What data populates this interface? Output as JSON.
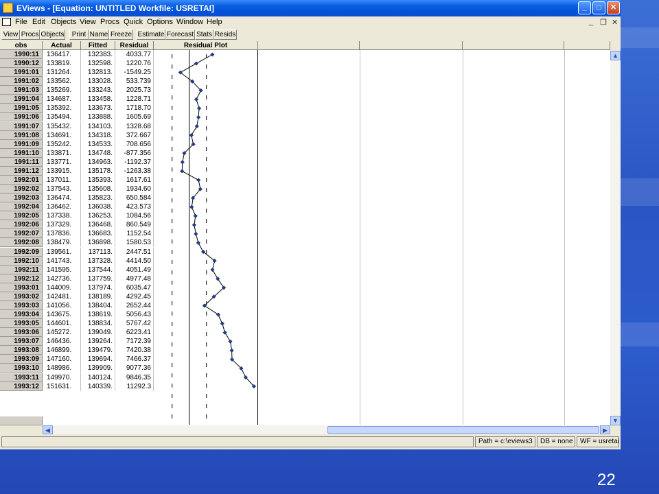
{
  "window": {
    "title": "EViews - [Equation: UNTITLED   Workfile: USRETAI]",
    "controls": {
      "minimize": "_",
      "restore": "□",
      "close": "✕"
    }
  },
  "menu": {
    "items": [
      "File",
      "Edit",
      "Objects",
      "View",
      "Procs",
      "Quick",
      "Options",
      "Window",
      "Help"
    ],
    "mdi": {
      "minimize": "_",
      "restore": "❐",
      "close": "✕"
    }
  },
  "toolbar": {
    "buttons": [
      "View",
      "Procs",
      "Objects",
      "Print",
      "Name",
      "Freeze",
      "Estimate",
      "Forecast",
      "Stats",
      "Resids"
    ]
  },
  "table": {
    "headers": {
      "obs": "obs",
      "actual": "Actual",
      "fitted": "Fitted",
      "residual": "Residual",
      "plot": "Residual Plot"
    },
    "rows": [
      {
        "obs": "1990:11",
        "actual": "136417.",
        "fitted": "132383.",
        "residual": "4033.77"
      },
      {
        "obs": "1990:12",
        "actual": "133819.",
        "fitted": "132598.",
        "residual": "1220.76"
      },
      {
        "obs": "1991:01",
        "actual": "131264.",
        "fitted": "132813.",
        "residual": "-1549.25"
      },
      {
        "obs": "1991:02",
        "actual": "133562.",
        "fitted": "133028.",
        "residual": "533.739"
      },
      {
        "obs": "1991:03",
        "actual": "135269.",
        "fitted": "133243.",
        "residual": "2025.73"
      },
      {
        "obs": "1991:04",
        "actual": "134687.",
        "fitted": "133458.",
        "residual": "1228.71"
      },
      {
        "obs": "1991:05",
        "actual": "135392.",
        "fitted": "133673.",
        "residual": "1718.70"
      },
      {
        "obs": "1991:06",
        "actual": "135494.",
        "fitted": "133888.",
        "residual": "1605.69"
      },
      {
        "obs": "1991:07",
        "actual": "135432.",
        "fitted": "134103.",
        "residual": "1328.68"
      },
      {
        "obs": "1991:08",
        "actual": "134691.",
        "fitted": "134318.",
        "residual": "372.667"
      },
      {
        "obs": "1991:09",
        "actual": "135242.",
        "fitted": "134533.",
        "residual": "708.656"
      },
      {
        "obs": "1991:10",
        "actual": "133871.",
        "fitted": "134748.",
        "residual": "-877.356"
      },
      {
        "obs": "1991:11",
        "actual": "133771.",
        "fitted": "134963.",
        "residual": "-1192.37"
      },
      {
        "obs": "1991:12",
        "actual": "133915.",
        "fitted": "135178.",
        "residual": "-1263.38"
      },
      {
        "obs": "1992:01",
        "actual": "137011.",
        "fitted": "135393.",
        "residual": "1617.61"
      },
      {
        "obs": "1992:02",
        "actual": "137543.",
        "fitted": "135608.",
        "residual": "1934.60"
      },
      {
        "obs": "1992:03",
        "actual": "136474.",
        "fitted": "135823.",
        "residual": "650.584"
      },
      {
        "obs": "1992:04",
        "actual": "136462.",
        "fitted": "136038.",
        "residual": "423.573"
      },
      {
        "obs": "1992:05",
        "actual": "137338.",
        "fitted": "136253.",
        "residual": "1084.56"
      },
      {
        "obs": "1992:06",
        "actual": "137329.",
        "fitted": "136468.",
        "residual": "860.549"
      },
      {
        "obs": "1992:07",
        "actual": "137836.",
        "fitted": "136683.",
        "residual": "1152.54"
      },
      {
        "obs": "1992:08",
        "actual": "138479.",
        "fitted": "136898.",
        "residual": "1580.53"
      },
      {
        "obs": "1992:09",
        "actual": "139561.",
        "fitted": "137113.",
        "residual": "2447.51"
      },
      {
        "obs": "1992:10",
        "actual": "141743.",
        "fitted": "137328.",
        "residual": "4414.50"
      },
      {
        "obs": "1992:11",
        "actual": "141595.",
        "fitted": "137544.",
        "residual": "4051.49"
      },
      {
        "obs": "1992:12",
        "actual": "142736.",
        "fitted": "137759.",
        "residual": "4977.48"
      },
      {
        "obs": "1993:01",
        "actual": "144009.",
        "fitted": "137974.",
        "residual": "6035.47"
      },
      {
        "obs": "1993:02",
        "actual": "142481.",
        "fitted": "138189.",
        "residual": "4292.45"
      },
      {
        "obs": "1993:03",
        "actual": "141056.",
        "fitted": "138404.",
        "residual": "2652.44"
      },
      {
        "obs": "1993:04",
        "actual": "143675.",
        "fitted": "138619.",
        "residual": "5056.43"
      },
      {
        "obs": "1993:05",
        "actual": "144601.",
        "fitted": "138834.",
        "residual": "5767.42"
      },
      {
        "obs": "1993:06",
        "actual": "145272.",
        "fitted": "139049.",
        "residual": "6223.41"
      },
      {
        "obs": "1993:07",
        "actual": "146436.",
        "fitted": "139264.",
        "residual": "7172.39"
      },
      {
        "obs": "1993:08",
        "actual": "146899.",
        "fitted": "139479.",
        "residual": "7420.38"
      },
      {
        "obs": "1993:09",
        "actual": "147160.",
        "fitted": "139694.",
        "residual": "7466.37"
      },
      {
        "obs": "1993:10",
        "actual": "148986.",
        "fitted": "139909.",
        "residual": "9077.36"
      },
      {
        "obs": "1993:11",
        "actual": "149970.",
        "fitted": "140124.",
        "residual": "9846.35"
      },
      {
        "obs": "1993:12",
        "actual": "151631.",
        "fitted": "140339.",
        "residual": "11292.3"
      }
    ]
  },
  "residual_plot": {
    "zero": 0,
    "band": [
      -3000,
      3000
    ],
    "range": [
      -6200,
      11900
    ],
    "colors": {
      "line": "#000000",
      "marker": "#1f3f8f",
      "dashed": "#000000"
    }
  },
  "statusbar": {
    "path": "Path = c:\\eviews3",
    "db": "DB = none",
    "wf": "WF = usretai"
  },
  "slide": {
    "number": "22"
  }
}
